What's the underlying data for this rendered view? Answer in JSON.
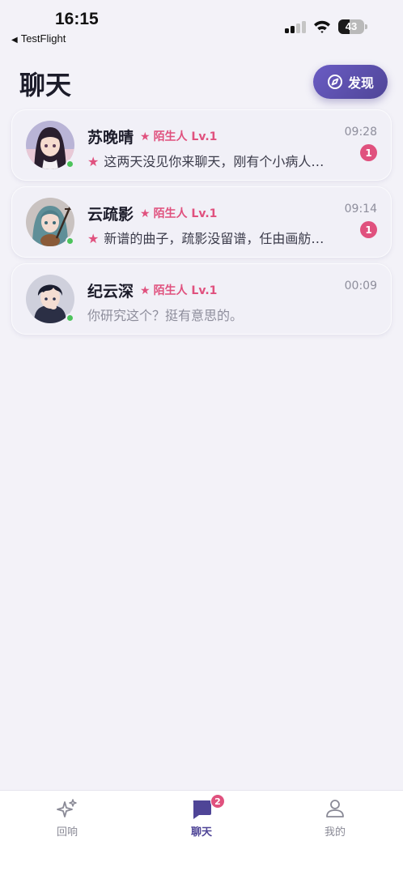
{
  "status_bar": {
    "time": "16:15",
    "back_app": "TestFlight",
    "battery": "43",
    "battery_level": 0.43
  },
  "header": {
    "title": "聊天",
    "discover_label": "发现"
  },
  "chats": [
    {
      "name": "苏晚晴",
      "tag": "陌生人 Lv.1",
      "time": "09:28",
      "preview": "这两天没见你来聊天，刚有个小病人…",
      "unread": "1",
      "online": true
    },
    {
      "name": "云疏影",
      "tag": "陌生人 Lv.1",
      "time": "09:14",
      "preview": "新谱的曲子，疏影没留谱，任由画舫…",
      "unread": "1",
      "online": true
    },
    {
      "name": "纪云深",
      "tag": "陌生人 Lv.1",
      "time": "00:09",
      "preview": "你研究这个？挺有意思的。",
      "unread": "",
      "online": true
    }
  ],
  "tab_bar": {
    "tabs": [
      {
        "label": "回响",
        "icon": "sparkles-icon"
      },
      {
        "label": "聊天",
        "icon": "chat-icon",
        "badge": "2"
      },
      {
        "label": "我的",
        "icon": "person-icon"
      }
    ]
  },
  "colors": {
    "accent": "#4f4597",
    "tag_pink": "#e0517e",
    "online_green": "#4cc35b",
    "background": "#f3f2f8"
  }
}
